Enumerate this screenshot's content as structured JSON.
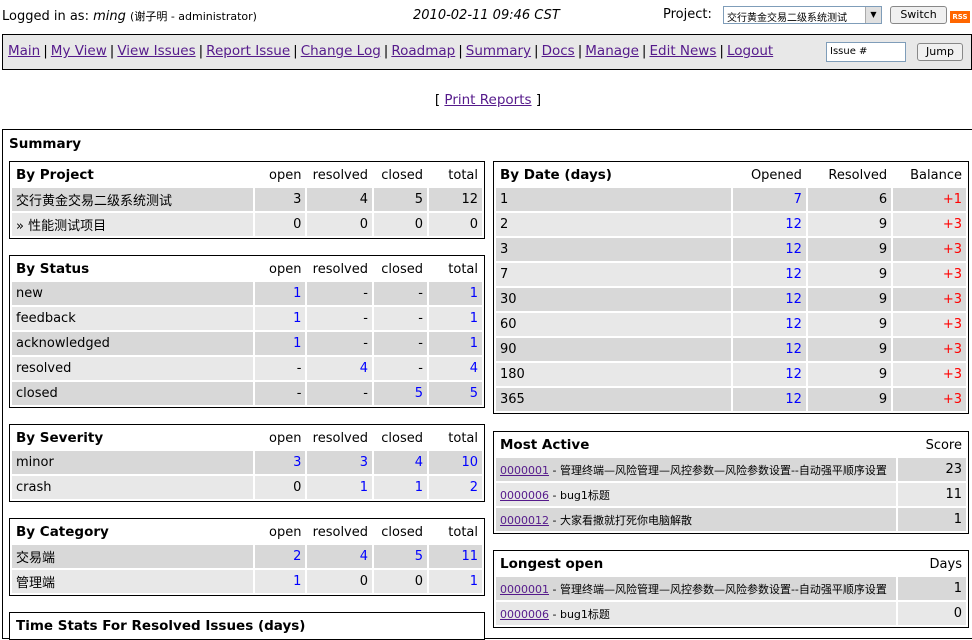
{
  "top": {
    "logged_in_label": "Logged in as:",
    "username": "ming",
    "realname": "(谢子明 - administrator)",
    "datetime": "2010-02-11 09:46 CST",
    "project_label": "Project:",
    "project_selected": "交行黄金交易二级系统测试",
    "switch_label": "Switch",
    "rss_label": "RSS"
  },
  "menu": {
    "items": [
      "Main",
      "My View",
      "View Issues",
      "Report Issue",
      "Change Log",
      "Roadmap",
      "Summary",
      "Docs",
      "Manage",
      "Edit News",
      "Logout"
    ],
    "issue_placeholder": "Issue #",
    "jump_label": "Jump"
  },
  "print_reports": {
    "open_bracket": "[",
    "label": "Print Reports",
    "close_bracket": "]"
  },
  "summary_title": "Summary",
  "by_project": {
    "title": "By Project",
    "cols": [
      "open",
      "resolved",
      "closed",
      "total"
    ],
    "rows": [
      {
        "name": "交行黄金交易二级系统测试",
        "open": "3",
        "resolved": "4",
        "closed": "5",
        "total": "12"
      },
      {
        "name": "» 性能测试项目",
        "open": "0",
        "resolved": "0",
        "closed": "0",
        "total": "0"
      }
    ]
  },
  "by_status": {
    "title": "By Status",
    "cols": [
      "open",
      "resolved",
      "closed",
      "total"
    ],
    "rows": [
      {
        "name": "new",
        "open": "1",
        "resolved": "-",
        "closed": "-",
        "total": "1"
      },
      {
        "name": "feedback",
        "open": "1",
        "resolved": "-",
        "closed": "-",
        "total": "1"
      },
      {
        "name": "acknowledged",
        "open": "1",
        "resolved": "-",
        "closed": "-",
        "total": "1"
      },
      {
        "name": "resolved",
        "open": "-",
        "resolved": "4",
        "closed": "-",
        "total": "4"
      },
      {
        "name": "closed",
        "open": "-",
        "resolved": "-",
        "closed": "5",
        "total": "5"
      }
    ]
  },
  "by_severity": {
    "title": "By Severity",
    "cols": [
      "open",
      "resolved",
      "closed",
      "total"
    ],
    "rows": [
      {
        "name": "minor",
        "open": "3",
        "resolved": "3",
        "closed": "4",
        "total": "10"
      },
      {
        "name": "crash",
        "open": "0",
        "resolved": "1",
        "closed": "1",
        "total": "2"
      }
    ]
  },
  "by_category": {
    "title": "By Category",
    "cols": [
      "open",
      "resolved",
      "closed",
      "total"
    ],
    "rows": [
      {
        "name": "交易端",
        "open": "2",
        "resolved": "4",
        "closed": "5",
        "total": "11"
      },
      {
        "name": "管理端",
        "open": "1",
        "resolved": "0",
        "closed": "0",
        "total": "1"
      }
    ]
  },
  "time_stats": {
    "title": "Time Stats For Resolved Issues (days)"
  },
  "by_date": {
    "title": "By Date (days)",
    "cols": [
      "Opened",
      "Resolved",
      "Balance"
    ],
    "rows": [
      {
        "days": "1",
        "opened": "7",
        "resolved": "6",
        "balance": "+1"
      },
      {
        "days": "2",
        "opened": "12",
        "resolved": "9",
        "balance": "+3"
      },
      {
        "days": "3",
        "opened": "12",
        "resolved": "9",
        "balance": "+3"
      },
      {
        "days": "7",
        "opened": "12",
        "resolved": "9",
        "balance": "+3"
      },
      {
        "days": "30",
        "opened": "12",
        "resolved": "9",
        "balance": "+3"
      },
      {
        "days": "60",
        "opened": "12",
        "resolved": "9",
        "balance": "+3"
      },
      {
        "days": "90",
        "opened": "12",
        "resolved": "9",
        "balance": "+3"
      },
      {
        "days": "180",
        "opened": "12",
        "resolved": "9",
        "balance": "+3"
      },
      {
        "days": "365",
        "opened": "12",
        "resolved": "9",
        "balance": "+3"
      }
    ]
  },
  "most_active": {
    "title": "Most Active",
    "col": "Score",
    "rows": [
      {
        "id": "0000001",
        "summary": " - 管理终端—风险管理—风控参数—风险参数设置--自动强平顺序设置",
        "value": "23"
      },
      {
        "id": "0000006",
        "summary": " - bug1标题",
        "value": "11"
      },
      {
        "id": "0000012",
        "summary": " - 大家看撒就打死你电脑解散",
        "value": "1"
      }
    ]
  },
  "longest_open": {
    "title": "Longest open",
    "col": "Days",
    "rows": [
      {
        "id": "0000001",
        "summary": " - 管理终端—风险管理—风控参数—风险参数设置--自动强平顺序设置",
        "value": "1"
      },
      {
        "id": "0000006",
        "summary": " - bug1标题",
        "value": "0"
      }
    ]
  }
}
